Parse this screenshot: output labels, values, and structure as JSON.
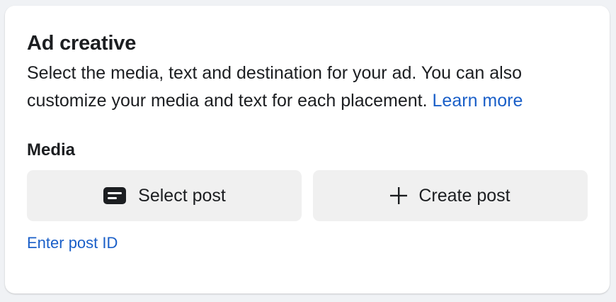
{
  "card": {
    "title": "Ad creative",
    "description": "Select the media, text and destination for your ad. You can also customize your media and text for each placement.",
    "learn_more": "Learn more"
  },
  "media": {
    "label": "Media",
    "select_post": {
      "label": "Select post",
      "icon": "post-icon"
    },
    "create_post": {
      "label": "Create post",
      "icon": "plus-icon"
    },
    "enter_post_id": "Enter post ID"
  },
  "colors": {
    "link": "#1a5fc8",
    "button_bg": "#f0f0f0",
    "text": "#1c1e21",
    "page_bg": "#f0f2f5"
  }
}
